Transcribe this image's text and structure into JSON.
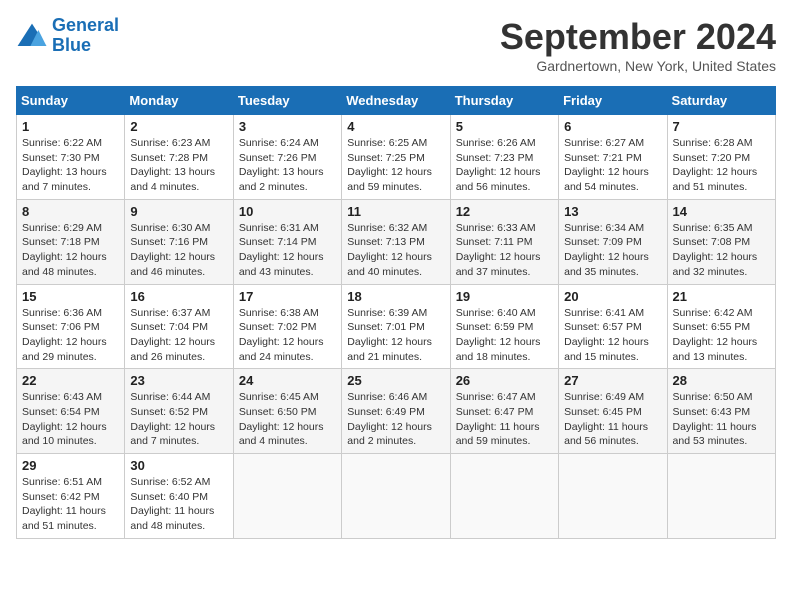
{
  "header": {
    "logo_line1": "General",
    "logo_line2": "Blue",
    "month_title": "September 2024",
    "location": "Gardnertown, New York, United States"
  },
  "weekdays": [
    "Sunday",
    "Monday",
    "Tuesday",
    "Wednesday",
    "Thursday",
    "Friday",
    "Saturday"
  ],
  "weeks": [
    [
      {
        "day": "1",
        "info": "Sunrise: 6:22 AM\nSunset: 7:30 PM\nDaylight: 13 hours\nand 7 minutes."
      },
      {
        "day": "2",
        "info": "Sunrise: 6:23 AM\nSunset: 7:28 PM\nDaylight: 13 hours\nand 4 minutes."
      },
      {
        "day": "3",
        "info": "Sunrise: 6:24 AM\nSunset: 7:26 PM\nDaylight: 13 hours\nand 2 minutes."
      },
      {
        "day": "4",
        "info": "Sunrise: 6:25 AM\nSunset: 7:25 PM\nDaylight: 12 hours\nand 59 minutes."
      },
      {
        "day": "5",
        "info": "Sunrise: 6:26 AM\nSunset: 7:23 PM\nDaylight: 12 hours\nand 56 minutes."
      },
      {
        "day": "6",
        "info": "Sunrise: 6:27 AM\nSunset: 7:21 PM\nDaylight: 12 hours\nand 54 minutes."
      },
      {
        "day": "7",
        "info": "Sunrise: 6:28 AM\nSunset: 7:20 PM\nDaylight: 12 hours\nand 51 minutes."
      }
    ],
    [
      {
        "day": "8",
        "info": "Sunrise: 6:29 AM\nSunset: 7:18 PM\nDaylight: 12 hours\nand 48 minutes."
      },
      {
        "day": "9",
        "info": "Sunrise: 6:30 AM\nSunset: 7:16 PM\nDaylight: 12 hours\nand 46 minutes."
      },
      {
        "day": "10",
        "info": "Sunrise: 6:31 AM\nSunset: 7:14 PM\nDaylight: 12 hours\nand 43 minutes."
      },
      {
        "day": "11",
        "info": "Sunrise: 6:32 AM\nSunset: 7:13 PM\nDaylight: 12 hours\nand 40 minutes."
      },
      {
        "day": "12",
        "info": "Sunrise: 6:33 AM\nSunset: 7:11 PM\nDaylight: 12 hours\nand 37 minutes."
      },
      {
        "day": "13",
        "info": "Sunrise: 6:34 AM\nSunset: 7:09 PM\nDaylight: 12 hours\nand 35 minutes."
      },
      {
        "day": "14",
        "info": "Sunrise: 6:35 AM\nSunset: 7:08 PM\nDaylight: 12 hours\nand 32 minutes."
      }
    ],
    [
      {
        "day": "15",
        "info": "Sunrise: 6:36 AM\nSunset: 7:06 PM\nDaylight: 12 hours\nand 29 minutes."
      },
      {
        "day": "16",
        "info": "Sunrise: 6:37 AM\nSunset: 7:04 PM\nDaylight: 12 hours\nand 26 minutes."
      },
      {
        "day": "17",
        "info": "Sunrise: 6:38 AM\nSunset: 7:02 PM\nDaylight: 12 hours\nand 24 minutes."
      },
      {
        "day": "18",
        "info": "Sunrise: 6:39 AM\nSunset: 7:01 PM\nDaylight: 12 hours\nand 21 minutes."
      },
      {
        "day": "19",
        "info": "Sunrise: 6:40 AM\nSunset: 6:59 PM\nDaylight: 12 hours\nand 18 minutes."
      },
      {
        "day": "20",
        "info": "Sunrise: 6:41 AM\nSunset: 6:57 PM\nDaylight: 12 hours\nand 15 minutes."
      },
      {
        "day": "21",
        "info": "Sunrise: 6:42 AM\nSunset: 6:55 PM\nDaylight: 12 hours\nand 13 minutes."
      }
    ],
    [
      {
        "day": "22",
        "info": "Sunrise: 6:43 AM\nSunset: 6:54 PM\nDaylight: 12 hours\nand 10 minutes."
      },
      {
        "day": "23",
        "info": "Sunrise: 6:44 AM\nSunset: 6:52 PM\nDaylight: 12 hours\nand 7 minutes."
      },
      {
        "day": "24",
        "info": "Sunrise: 6:45 AM\nSunset: 6:50 PM\nDaylight: 12 hours\nand 4 minutes."
      },
      {
        "day": "25",
        "info": "Sunrise: 6:46 AM\nSunset: 6:49 PM\nDaylight: 12 hours\nand 2 minutes."
      },
      {
        "day": "26",
        "info": "Sunrise: 6:47 AM\nSunset: 6:47 PM\nDaylight: 11 hours\nand 59 minutes."
      },
      {
        "day": "27",
        "info": "Sunrise: 6:49 AM\nSunset: 6:45 PM\nDaylight: 11 hours\nand 56 minutes."
      },
      {
        "day": "28",
        "info": "Sunrise: 6:50 AM\nSunset: 6:43 PM\nDaylight: 11 hours\nand 53 minutes."
      }
    ],
    [
      {
        "day": "29",
        "info": "Sunrise: 6:51 AM\nSunset: 6:42 PM\nDaylight: 11 hours\nand 51 minutes."
      },
      {
        "day": "30",
        "info": "Sunrise: 6:52 AM\nSunset: 6:40 PM\nDaylight: 11 hours\nand 48 minutes."
      },
      {
        "day": "",
        "info": ""
      },
      {
        "day": "",
        "info": ""
      },
      {
        "day": "",
        "info": ""
      },
      {
        "day": "",
        "info": ""
      },
      {
        "day": "",
        "info": ""
      }
    ]
  ]
}
